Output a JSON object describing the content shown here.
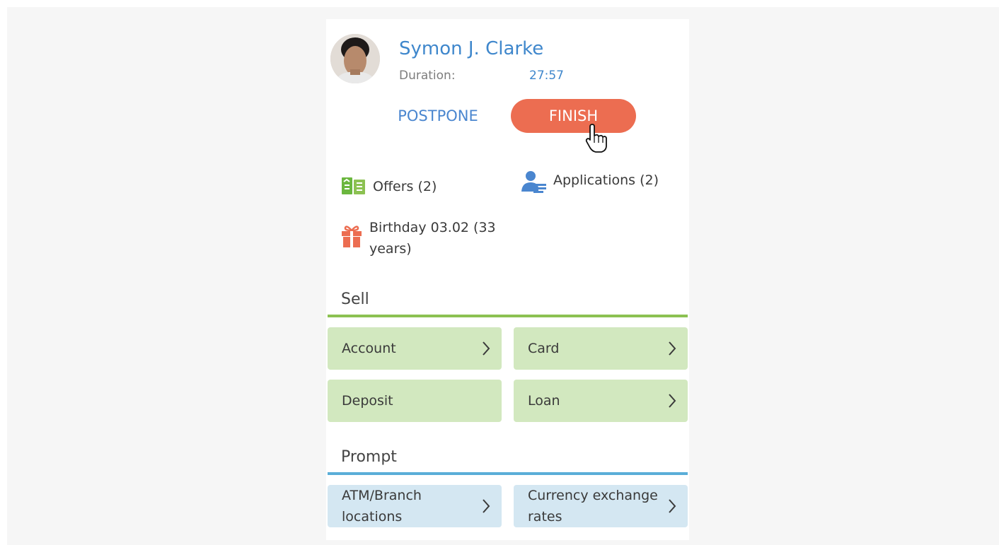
{
  "contact": {
    "name": "Symon J. Clarke",
    "duration_label": "Duration:",
    "duration_value": "27:57"
  },
  "actions": {
    "postpone_label": "POSTPONE",
    "finish_label": "FINISH"
  },
  "info": {
    "offers": "Offers (2)",
    "applications": "Applications (2)",
    "birthday_line1": "Birthday 03.02 (33",
    "birthday_line2": "years)"
  },
  "sell": {
    "title": "Sell",
    "accent": "#8cc152",
    "tiles": [
      {
        "label": "Account"
      },
      {
        "label": "Card"
      },
      {
        "label": "Deposit"
      },
      {
        "label": "Loan"
      }
    ]
  },
  "prompt": {
    "title": "Prompt",
    "accent": "#5aaed8",
    "tiles": [
      {
        "line1": "ATM/Branch",
        "line2": "locations"
      },
      {
        "line1": "Currency exchange",
        "line2": "rates"
      }
    ]
  },
  "icons": {
    "offers": "offers-icon",
    "applications": "applications-icon",
    "birthday": "gift-icon",
    "chevron": "chevron-right-icon",
    "cursor": "hand-pointer-icon"
  },
  "colors": {
    "name_blue": "#3f87cc",
    "finish_orange": "#ec6d51",
    "background": "#f6f6f6"
  }
}
